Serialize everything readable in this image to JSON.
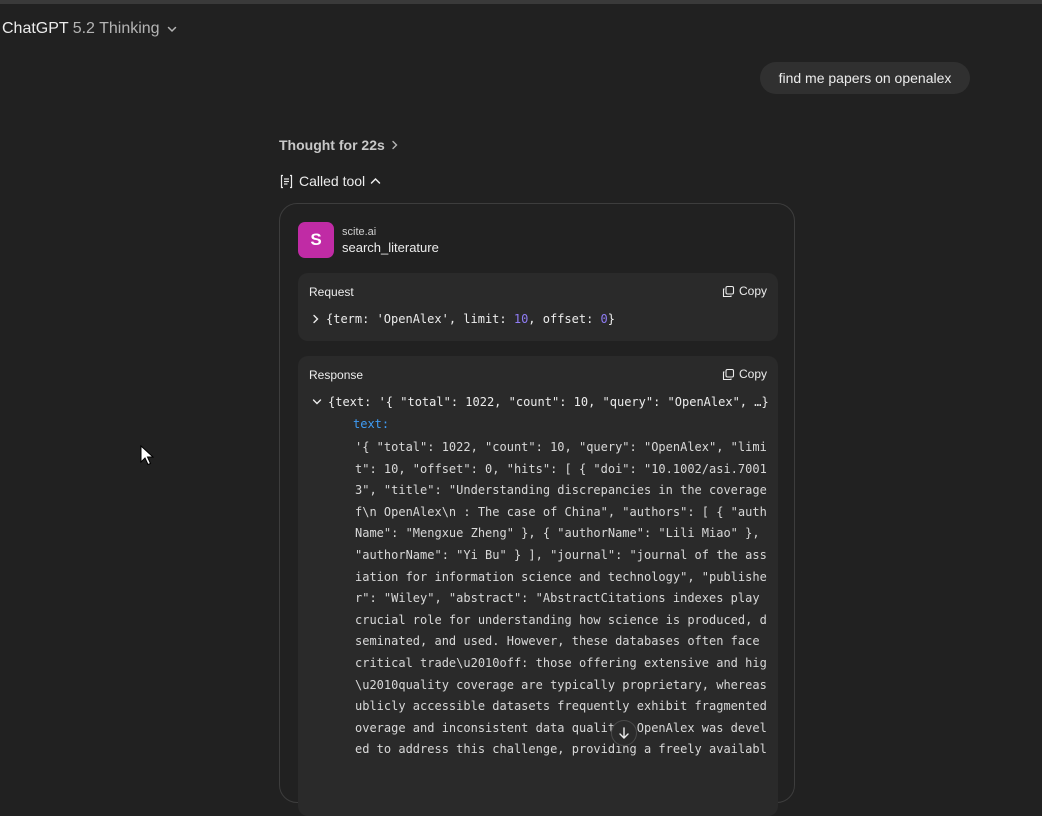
{
  "header": {
    "model_name": "ChatGPT",
    "model_version": "5.2 Thinking"
  },
  "conversation": {
    "user_message": "find me papers on openalex",
    "thought_label": "Thought for 22s",
    "called_tool_label": "Called tool"
  },
  "tool": {
    "avatar_letter": "S",
    "provider": "scite.ai",
    "name": "search_literature",
    "request": {
      "title": "Request",
      "copy_label": "Copy",
      "args_prefix": "{term: 'OpenAlex', limit: ",
      "limit": "10",
      "args_mid": ", offset: ",
      "offset": "0",
      "args_suffix": "}"
    },
    "response": {
      "title": "Response",
      "copy_label": "Copy",
      "summary": "{text: '{ \"total\": 1022, \"count\": 10, \"query\": \"OpenAlex\", …}",
      "text_key": "text:",
      "text_lines": [
        "'{ \"total\": 1022, \"count\": 10, \"query\": \"OpenAlex\", \"limi",
        "t\": 10, \"offset\": 0, \"hits\": [ { \"doi\": \"10.1002/asi.7001",
        "3\", \"title\": \"Understanding discrepancies in the coverage o",
        "f\\n OpenAlex\\n : The case of China\", \"authors\": [ { \"author",
        "Name\": \"Mengxue Zheng\" }, { \"authorName\": \"Lili Miao\" }, {",
        "\"authorName\": \"Yi Bu\" } ], \"journal\": \"journal of the assoc",
        "iation for information science and technology\", \"publishe",
        "r\": \"Wiley\", \"abstract\": \"AbstractCitations indexes play a",
        "crucial role for understanding how science is produced, dis",
        "seminated, and used. However, these databases often face a",
        "critical trade\\u2010off: those offering extensive and high",
        "\\u2010quality coverage are typically proprietary, whereas p",
        "ublicly accessible datasets frequently exhibit fragmented c",
        "overage and inconsistent data quality. OpenAlex was develop",
        "ed to address this challenge, providing a freely available"
      ]
    }
  },
  "colors": {
    "background": "#212121",
    "avatar": "#c02ba5",
    "number": "#8f7cf4",
    "key": "#3f9cf5"
  },
  "icons": {
    "model_chevron": "chevron-down-icon",
    "thought_chevron": "chevron-right-icon",
    "tool": "tool-icon",
    "tool_chevron": "chevron-up-icon",
    "copy": "copy-icon",
    "expand": "chevron-right-icon",
    "collapse": "chevron-down-icon",
    "scroll": "arrow-down-icon",
    "cursor": "mouse-cursor-icon"
  }
}
